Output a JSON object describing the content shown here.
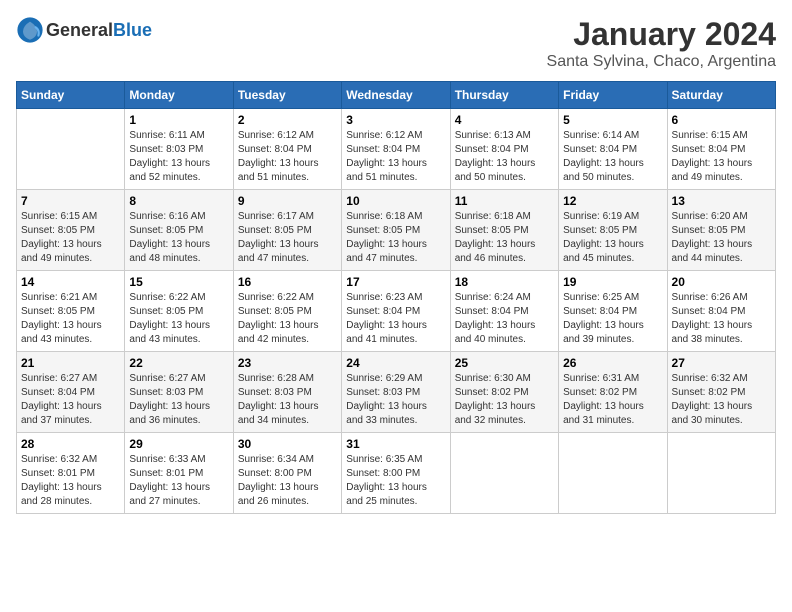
{
  "logo": {
    "text_general": "General",
    "text_blue": "Blue"
  },
  "title": "January 2024",
  "subtitle": "Santa Sylvina, Chaco, Argentina",
  "calendar": {
    "headers": [
      "Sunday",
      "Monday",
      "Tuesday",
      "Wednesday",
      "Thursday",
      "Friday",
      "Saturday"
    ],
    "weeks": [
      [
        {
          "day": "",
          "info": ""
        },
        {
          "day": "1",
          "info": "Sunrise: 6:11 AM\nSunset: 8:03 PM\nDaylight: 13 hours\nand 52 minutes."
        },
        {
          "day": "2",
          "info": "Sunrise: 6:12 AM\nSunset: 8:04 PM\nDaylight: 13 hours\nand 51 minutes."
        },
        {
          "day": "3",
          "info": "Sunrise: 6:12 AM\nSunset: 8:04 PM\nDaylight: 13 hours\nand 51 minutes."
        },
        {
          "day": "4",
          "info": "Sunrise: 6:13 AM\nSunset: 8:04 PM\nDaylight: 13 hours\nand 50 minutes."
        },
        {
          "day": "5",
          "info": "Sunrise: 6:14 AM\nSunset: 8:04 PM\nDaylight: 13 hours\nand 50 minutes."
        },
        {
          "day": "6",
          "info": "Sunrise: 6:15 AM\nSunset: 8:04 PM\nDaylight: 13 hours\nand 49 minutes."
        }
      ],
      [
        {
          "day": "7",
          "info": "Sunrise: 6:15 AM\nSunset: 8:05 PM\nDaylight: 13 hours\nand 49 minutes."
        },
        {
          "day": "8",
          "info": "Sunrise: 6:16 AM\nSunset: 8:05 PM\nDaylight: 13 hours\nand 48 minutes."
        },
        {
          "day": "9",
          "info": "Sunrise: 6:17 AM\nSunset: 8:05 PM\nDaylight: 13 hours\nand 47 minutes."
        },
        {
          "day": "10",
          "info": "Sunrise: 6:18 AM\nSunset: 8:05 PM\nDaylight: 13 hours\nand 47 minutes."
        },
        {
          "day": "11",
          "info": "Sunrise: 6:18 AM\nSunset: 8:05 PM\nDaylight: 13 hours\nand 46 minutes."
        },
        {
          "day": "12",
          "info": "Sunrise: 6:19 AM\nSunset: 8:05 PM\nDaylight: 13 hours\nand 45 minutes."
        },
        {
          "day": "13",
          "info": "Sunrise: 6:20 AM\nSunset: 8:05 PM\nDaylight: 13 hours\nand 44 minutes."
        }
      ],
      [
        {
          "day": "14",
          "info": "Sunrise: 6:21 AM\nSunset: 8:05 PM\nDaylight: 13 hours\nand 43 minutes."
        },
        {
          "day": "15",
          "info": "Sunrise: 6:22 AM\nSunset: 8:05 PM\nDaylight: 13 hours\nand 43 minutes."
        },
        {
          "day": "16",
          "info": "Sunrise: 6:22 AM\nSunset: 8:05 PM\nDaylight: 13 hours\nand 42 minutes."
        },
        {
          "day": "17",
          "info": "Sunrise: 6:23 AM\nSunset: 8:04 PM\nDaylight: 13 hours\nand 41 minutes."
        },
        {
          "day": "18",
          "info": "Sunrise: 6:24 AM\nSunset: 8:04 PM\nDaylight: 13 hours\nand 40 minutes."
        },
        {
          "day": "19",
          "info": "Sunrise: 6:25 AM\nSunset: 8:04 PM\nDaylight: 13 hours\nand 39 minutes."
        },
        {
          "day": "20",
          "info": "Sunrise: 6:26 AM\nSunset: 8:04 PM\nDaylight: 13 hours\nand 38 minutes."
        }
      ],
      [
        {
          "day": "21",
          "info": "Sunrise: 6:27 AM\nSunset: 8:04 PM\nDaylight: 13 hours\nand 37 minutes."
        },
        {
          "day": "22",
          "info": "Sunrise: 6:27 AM\nSunset: 8:03 PM\nDaylight: 13 hours\nand 36 minutes."
        },
        {
          "day": "23",
          "info": "Sunrise: 6:28 AM\nSunset: 8:03 PM\nDaylight: 13 hours\nand 34 minutes."
        },
        {
          "day": "24",
          "info": "Sunrise: 6:29 AM\nSunset: 8:03 PM\nDaylight: 13 hours\nand 33 minutes."
        },
        {
          "day": "25",
          "info": "Sunrise: 6:30 AM\nSunset: 8:02 PM\nDaylight: 13 hours\nand 32 minutes."
        },
        {
          "day": "26",
          "info": "Sunrise: 6:31 AM\nSunset: 8:02 PM\nDaylight: 13 hours\nand 31 minutes."
        },
        {
          "day": "27",
          "info": "Sunrise: 6:32 AM\nSunset: 8:02 PM\nDaylight: 13 hours\nand 30 minutes."
        }
      ],
      [
        {
          "day": "28",
          "info": "Sunrise: 6:32 AM\nSunset: 8:01 PM\nDaylight: 13 hours\nand 28 minutes."
        },
        {
          "day": "29",
          "info": "Sunrise: 6:33 AM\nSunset: 8:01 PM\nDaylight: 13 hours\nand 27 minutes."
        },
        {
          "day": "30",
          "info": "Sunrise: 6:34 AM\nSunset: 8:00 PM\nDaylight: 13 hours\nand 26 minutes."
        },
        {
          "day": "31",
          "info": "Sunrise: 6:35 AM\nSunset: 8:00 PM\nDaylight: 13 hours\nand 25 minutes."
        },
        {
          "day": "",
          "info": ""
        },
        {
          "day": "",
          "info": ""
        },
        {
          "day": "",
          "info": ""
        }
      ]
    ]
  }
}
